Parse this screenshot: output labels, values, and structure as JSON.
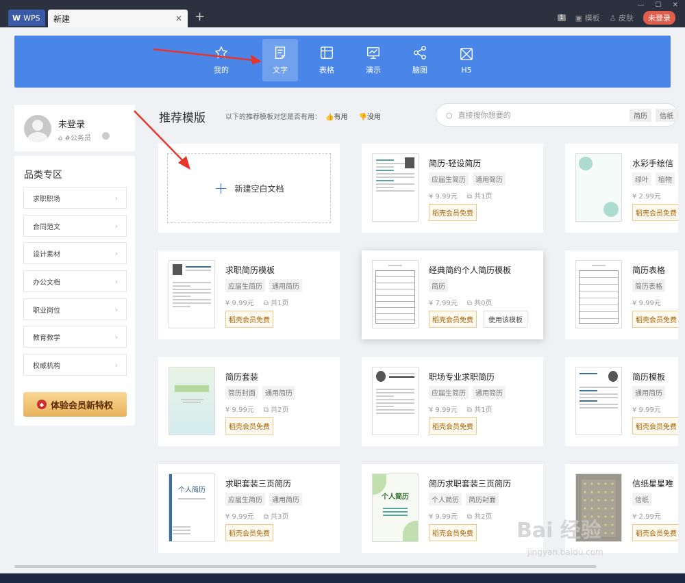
{
  "titlebar": {
    "wps_tab": "WPS",
    "doc_tab": "新建",
    "close": "✕",
    "new_tab": "+",
    "count_badge": "1",
    "template_label": "模板",
    "skin_label": "皮肤",
    "login_label": "未登录"
  },
  "categories": [
    {
      "label": "我的",
      "icon": "star-icon"
    },
    {
      "label": "文字",
      "icon": "document-icon"
    },
    {
      "label": "表格",
      "icon": "table-icon"
    },
    {
      "label": "演示",
      "icon": "presentation-icon"
    },
    {
      "label": "脑图",
      "icon": "mindmap-icon"
    },
    {
      "label": "H5",
      "icon": "h5-icon"
    }
  ],
  "user": {
    "name": "未登录",
    "tag": "#公务员"
  },
  "sidebar": {
    "title": "品类专区",
    "items": [
      "求职职场",
      "合同范文",
      "设计素材",
      "办公文档",
      "职业岗位",
      "教育教学",
      "权威机构"
    ],
    "vip_label": "体验会员新特权"
  },
  "main": {
    "title": "推荐模版",
    "feedback_text": "以下的推荐模板对您是否有用：",
    "useful": "有用",
    "useless": "没用",
    "search_placeholder": "直接搜你想要的",
    "search_tags": [
      "简历",
      "信纸"
    ],
    "blank_label": "新建空白文档",
    "vip_free": "稻壳会员免费",
    "use_template": "使用该模板"
  },
  "cards": [
    {
      "title": "简历-轻设简历",
      "tags": [
        "应届生简历",
        "通用简历"
      ],
      "price": "9.99元",
      "pages": "共1页"
    },
    {
      "title": "水彩手绘信",
      "tags": [
        "绿叶",
        "植物"
      ],
      "price": "2.99元",
      "pages": ""
    },
    {
      "title": "求职简历模板",
      "tags": [
        "应届生简历",
        "通用简历"
      ],
      "price": "9.99元",
      "pages": "共1页"
    },
    {
      "title": "经典简约个人简历模板",
      "tags": [
        "简历"
      ],
      "price": "7.99元",
      "pages": "共0页"
    },
    {
      "title": "简历表格",
      "tags": [
        "简历表格"
      ],
      "price": "9.99元",
      "pages": ""
    },
    {
      "title": "简历套装",
      "tags": [
        "简历封面",
        "通用简历"
      ],
      "price": "9.99元",
      "pages": "共2页"
    },
    {
      "title": "职场专业求职简历",
      "tags": [
        "应届生简历",
        "通用简历"
      ],
      "price": "9.99元",
      "pages": "共1页"
    },
    {
      "title": "简历模板",
      "tags": [
        "通用简历"
      ],
      "price": "9.99元",
      "pages": ""
    },
    {
      "title": "求职套装三页简历",
      "tags": [
        "应届生简历",
        "通用简历"
      ],
      "price": "9.99元",
      "pages": "共3页"
    },
    {
      "title": "简历求职套装三页简历",
      "tags": [
        "个人简历",
        "简历封面"
      ],
      "price": "9.99元",
      "pages": "共2页"
    },
    {
      "title": "信纸星星唯",
      "tags": [
        "信纸"
      ],
      "price": "2.99元",
      "pages": ""
    }
  ],
  "thumb_text": {
    "cover1": "个人简历",
    "cover2": "个人简历"
  },
  "watermark": {
    "main": "Bai 经验",
    "sub": "jingyan.baidu.com"
  },
  "colors": {
    "accent": "#4a86e8",
    "titlebar": "#2c3140",
    "login": "#e05d4c",
    "vip": "#e8b25c"
  }
}
